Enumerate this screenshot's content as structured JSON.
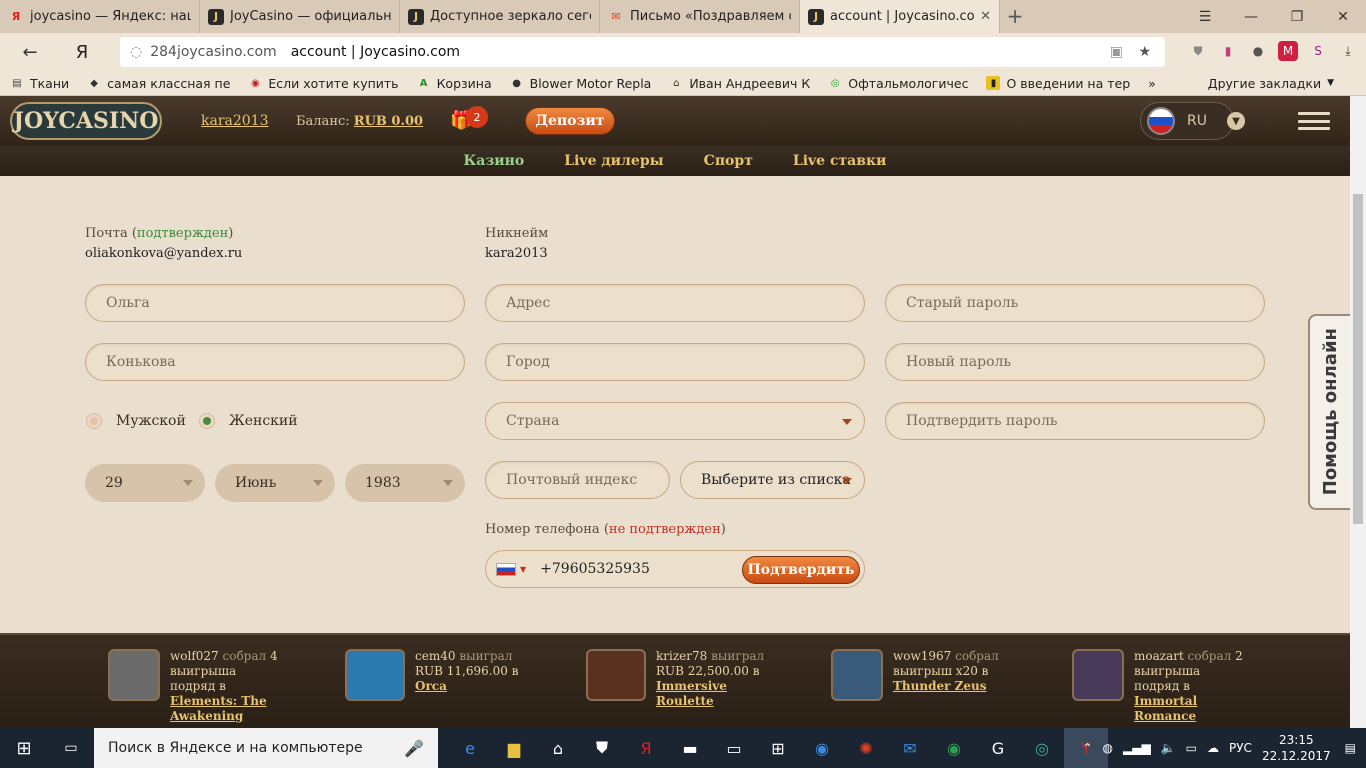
{
  "browser": {
    "tabs": [
      {
        "title": "joycasino — Яндекс: нашло",
        "icon": "Я"
      },
      {
        "title": "JoyCasino — официальный",
        "icon": "J"
      },
      {
        "title": "Доступное зеркало сегодня",
        "icon": "J"
      },
      {
        "title": "Письмо «Поздравляем с ре",
        "icon": "✉"
      },
      {
        "title": "account | Joycasino.com",
        "icon": "J"
      }
    ],
    "back": "←",
    "home": "Я",
    "domain": "284joycasino.com",
    "page_title": "account | Joycasino.com",
    "bookmarks": [
      {
        "label": "Ткани"
      },
      {
        "label": "самая классная пе"
      },
      {
        "label": "Если хотите купить"
      },
      {
        "label": "Корзина"
      },
      {
        "label": "Blower Motor Repla"
      },
      {
        "label": "Иван Андреевич К"
      },
      {
        "label": "Офтальмологичес"
      },
      {
        "label": "О введении на тер"
      }
    ],
    "bookmarks_more": "»",
    "other_bookmarks": "Другие закладки"
  },
  "site": {
    "logo": "JOYCASINO",
    "username": "kara2013",
    "balance_label": "Баланс:",
    "balance_value": "RUB 0.00",
    "gift_count": "2",
    "deposit_label": "Депозит",
    "lang": "RU",
    "nav": [
      "Казино",
      "Live дилеры",
      "Спорт",
      "Live ставки"
    ]
  },
  "form": {
    "email_label": "Почта",
    "email_status": "подтвержден",
    "email_value": "oliakonkova@yandex.ru",
    "nick_label": "Никнейм",
    "nick_value": "kara2013",
    "first_name": "Ольга",
    "last_name": "Конькова",
    "gender_male": "Мужской",
    "gender_female": "Женский",
    "dob_day": "29",
    "dob_month": "Июнь",
    "dob_year": "1983",
    "address_ph": "Адрес",
    "city_ph": "Город",
    "country_ph": "Страна",
    "zip_ph": "Почтовый индекс",
    "choose_ph": "Выберите из списка",
    "phone_label": "Номер телефона",
    "phone_status": "не подтвержден",
    "phone_value": "+79605325935",
    "confirm_label": "Подтвердить",
    "old_pw_ph": "Старый пароль",
    "new_pw_ph": "Новый пароль",
    "confirm_pw_ph": "Подтвердить пароль"
  },
  "help_label": "Помощь онлайн",
  "winners": [
    {
      "user": "wolf027",
      "verb": "собрал",
      "amount": "4",
      "suffix": "выигрыша подряд в",
      "game": "Elements: The Awakening",
      "color": "#6a6a6a"
    },
    {
      "user": "cem40",
      "verb": "выиграл",
      "amount": "RUB 11,696.00",
      "suffix": "в",
      "game": "Orca",
      "color": "#2a7ab0"
    },
    {
      "user": "krizer78",
      "verb": "выиграл",
      "amount": "RUB 22,500.00",
      "suffix": "в",
      "game": "Immersive Roulette",
      "color": "#5a3020"
    },
    {
      "user": "wow1967",
      "verb": "собрал",
      "amount": "выигрыш x20",
      "suffix": "в",
      "game": "Thunder Zeus",
      "color": "#3a5a7a"
    },
    {
      "user": "moazart",
      "verb": "собрал",
      "amount": "2",
      "suffix": "выигрыша подряд в",
      "game": "Immortal Romance",
      "color": "#4a3a5a"
    }
  ],
  "taskbar": {
    "search_text": "Поиск в Яндексе и на компьютере",
    "lang": "РУС",
    "time": "23:15",
    "date": "22.12.2017"
  }
}
